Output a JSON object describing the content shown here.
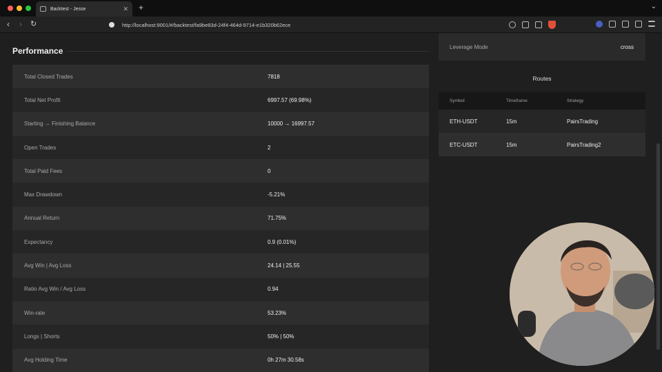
{
  "browser": {
    "tab_title": "Backtest - Jesse",
    "new_tab_symbol": "+",
    "url": "http://localhost:9001/#/backtest/fa9be83d-24f4-464d-9714-e1b320b62ece",
    "traffic_colors": [
      "#ff5f57",
      "#febc2e",
      "#28c840"
    ]
  },
  "performance": {
    "title": "Performance",
    "rows": [
      {
        "label": "Total Closed Trades",
        "value": "7818"
      },
      {
        "label": "Total Net Profit",
        "value": "6997.57 (69.98%)"
      },
      {
        "label": "Starting → Finishing Balance",
        "value": "10000 → 16997.57"
      },
      {
        "label": "Open Trades",
        "value": "2"
      },
      {
        "label": "Total Paid Fees",
        "value": "0"
      },
      {
        "label": "Max Drawdown",
        "value": "-5.21%"
      },
      {
        "label": "Annual Return",
        "value": "71.75%"
      },
      {
        "label": "Expectancy",
        "value": "0.9 (0.01%)"
      },
      {
        "label": "Avg Win | Avg Loss",
        "value": "24.14 | 25.55"
      },
      {
        "label": "Ratio Avg Win / Avg Loss",
        "value": "0.94"
      },
      {
        "label": "Win-rate",
        "value": "53.23%"
      },
      {
        "label": "Longs | Shorts",
        "value": "50% | 50%"
      },
      {
        "label": "Avg Holding Time",
        "value": "0h 27m 30.58s"
      }
    ]
  },
  "leverage": {
    "label": "Leverage Mode",
    "value": "cross"
  },
  "routes": {
    "title": "Routes",
    "headers": [
      "Symbol",
      "Timeframe",
      "Strategy"
    ],
    "rows": [
      {
        "symbol": "ETH-USDT",
        "timeframe": "15m",
        "strategy": "PairsTrading"
      },
      {
        "symbol": "ETC-USDT",
        "timeframe": "15m",
        "strategy": "PairsTrading2"
      }
    ]
  }
}
